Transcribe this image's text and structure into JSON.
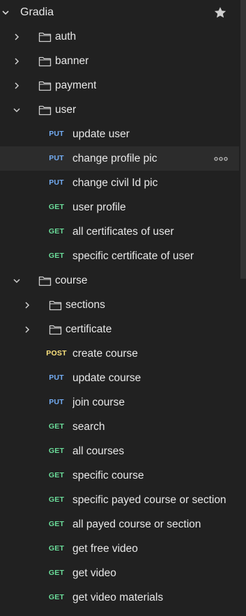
{
  "collection": {
    "name": "Gradia",
    "starred": true,
    "star_icon": "star-icon"
  },
  "colors": {
    "background": "#212121",
    "highlight_row": "#2c2c2c",
    "method_put": "#74aef6",
    "method_get": "#6bdd9a",
    "method_post": "#ffe47e",
    "text": "#e8e8e8"
  },
  "tree": [
    {
      "kind": "folder",
      "label": "auth",
      "expanded": false,
      "depth": 1
    },
    {
      "kind": "folder",
      "label": "banner",
      "expanded": false,
      "depth": 1
    },
    {
      "kind": "folder",
      "label": "payment",
      "expanded": false,
      "depth": 1
    },
    {
      "kind": "folder",
      "label": "user",
      "expanded": true,
      "depth": 1
    },
    {
      "kind": "request",
      "method": "PUT",
      "label": "update user",
      "depth": 2
    },
    {
      "kind": "request",
      "method": "PUT",
      "label": "change profile pic",
      "depth": 2,
      "highlight": true,
      "more_icon": "more-horizontal-icon"
    },
    {
      "kind": "request",
      "method": "PUT",
      "label": "change civil Id pic",
      "depth": 2
    },
    {
      "kind": "request",
      "method": "GET",
      "label": "user profile",
      "depth": 2
    },
    {
      "kind": "request",
      "method": "GET",
      "label": "all certificates of user",
      "depth": 2
    },
    {
      "kind": "request",
      "method": "GET",
      "label": "specific certificate of user",
      "depth": 2
    },
    {
      "kind": "folder",
      "label": "course",
      "expanded": true,
      "depth": 1
    },
    {
      "kind": "folder",
      "label": "sections",
      "expanded": false,
      "depth": 2
    },
    {
      "kind": "folder",
      "label": "certificate",
      "expanded": false,
      "depth": 2
    },
    {
      "kind": "request",
      "method": "POST",
      "label": "create course",
      "depth": 2
    },
    {
      "kind": "request",
      "method": "PUT",
      "label": "update course",
      "depth": 2
    },
    {
      "kind": "request",
      "method": "PUT",
      "label": "join course",
      "depth": 2
    },
    {
      "kind": "request",
      "method": "GET",
      "label": "search",
      "depth": 2
    },
    {
      "kind": "request",
      "method": "GET",
      "label": "all courses",
      "depth": 2
    },
    {
      "kind": "request",
      "method": "GET",
      "label": "specific course",
      "depth": 2
    },
    {
      "kind": "request",
      "method": "GET",
      "label": "specific payed course or section",
      "depth": 2
    },
    {
      "kind": "request",
      "method": "GET",
      "label": "all payed course or section",
      "depth": 2
    },
    {
      "kind": "request",
      "method": "GET",
      "label": "get free video",
      "depth": 2
    },
    {
      "kind": "request",
      "method": "GET",
      "label": "get video",
      "depth": 2
    },
    {
      "kind": "request",
      "method": "GET",
      "label": "get video materials",
      "depth": 2
    }
  ]
}
